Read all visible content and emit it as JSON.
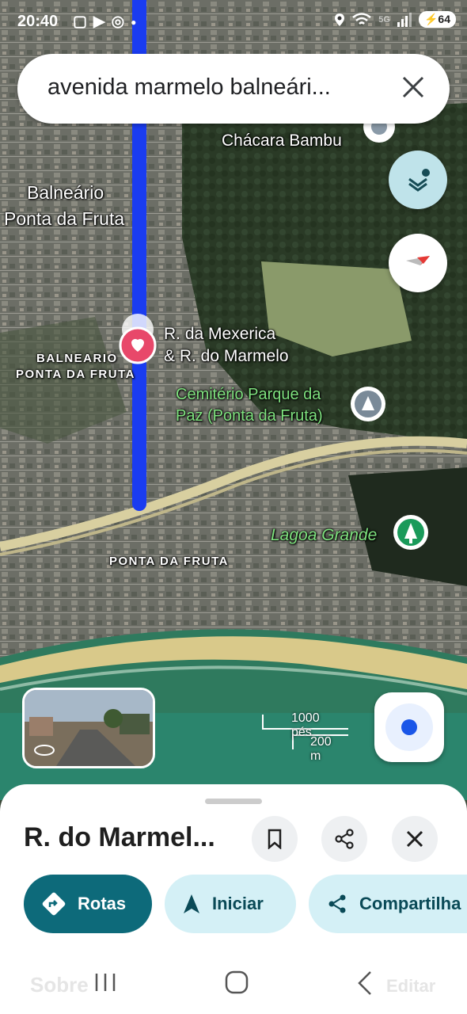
{
  "status_bar": {
    "time": "20:40",
    "battery": "64",
    "network": "5G"
  },
  "search": {
    "query": "avenida marmelo balneári..."
  },
  "map_labels": {
    "chacara": "Chácara Bambu",
    "balneario_line1": "Balneário",
    "balneario_line2": "Ponta da Fruta",
    "pin_line1": "R. da Mexerica",
    "pin_line2": "& R. do Marmelo",
    "district_line1": "BALNEARIO",
    "district_line2": "PONTA DA FRUTA",
    "cemetery_line1": "Cemitério Parque da",
    "cemetery_line2": "Paz (Ponta da Fruta)",
    "lagoa": "Lagoa Grande",
    "ponta": "PONTA DA FRUTA"
  },
  "scale": {
    "imperial": "1000 pés",
    "metric": "200 m"
  },
  "sheet": {
    "title": "R. do Marmel...",
    "buttons": {
      "directions": "Rotas",
      "start": "Iniciar",
      "share": "Compartilha"
    },
    "tabs_behind": {
      "about": "Sobre",
      "edit": "Editar"
    }
  },
  "colors": {
    "route": "#1a3cf0",
    "primary": "#0d6a7a",
    "chip": "#d4f0f6",
    "pin": "#e8486a"
  },
  "icons": [
    "wifi-icon",
    "signal-icon",
    "location-icon",
    "close-icon",
    "layers-icon",
    "compass-icon",
    "my-location-icon",
    "bookmark-icon",
    "share-icon",
    "directions-icon",
    "navigate-icon"
  ]
}
